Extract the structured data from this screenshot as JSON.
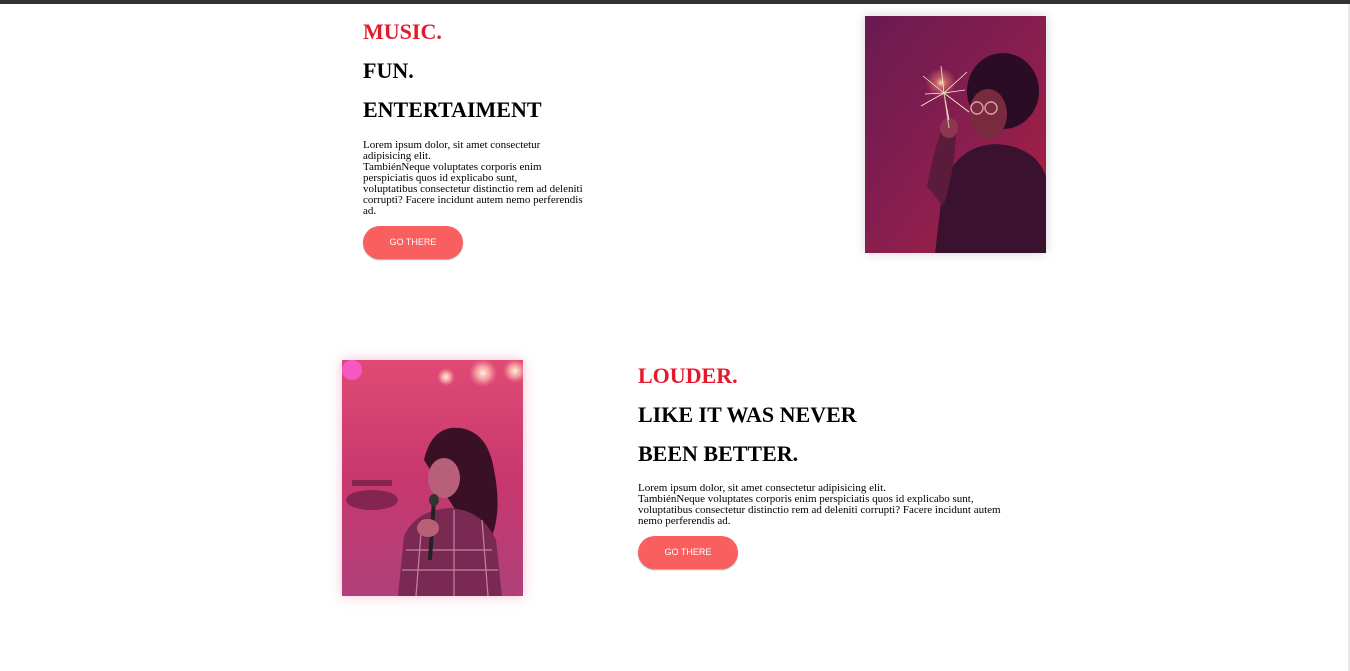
{
  "section_one": {
    "accent": "MUSIC.",
    "heading_line_1": "FUN.",
    "heading_line_2": "ENTERTAIMENT",
    "body_line_1": "Lorem ipsum dolor, sit amet consectetur",
    "body_line_2": "adipisicing elit.",
    "body_line_3": "TambiénNeque voluptates corporis enim",
    "body_line_4": "perspiciatis quos id explicabo sunt,",
    "body_line_5": "voluptatibus consectetur distinctio rem ad deleniti",
    "body_line_6": "corrupti? Facere incidunt autem nemo perferendis",
    "body_line_7": "ad.",
    "button_label": "GO THERE",
    "image": "man-with-sparkler-photo"
  },
  "section_two": {
    "accent": "LOUDER.",
    "heading_line_1": "LIKE IT WAS NEVER",
    "heading_line_2": "BEEN BETTER.",
    "body_line_1": "Lorem ipsum dolor, sit amet consectetur adipisicing elit.",
    "body_line_2": "TambiénNeque voluptates corporis enim perspiciatis quos id explicabo sunt,",
    "body_line_3": "voluptatibus consectetur distinctio rem ad deleniti corrupti? Facere incidunt autem",
    "body_line_4": "nemo perferendis ad.",
    "button_label": "GO THERE",
    "image": "singer-on-stage-photo"
  },
  "colors": {
    "accent": "#e3192c",
    "button": "#fa5f5f",
    "top_bar": "#333333"
  }
}
